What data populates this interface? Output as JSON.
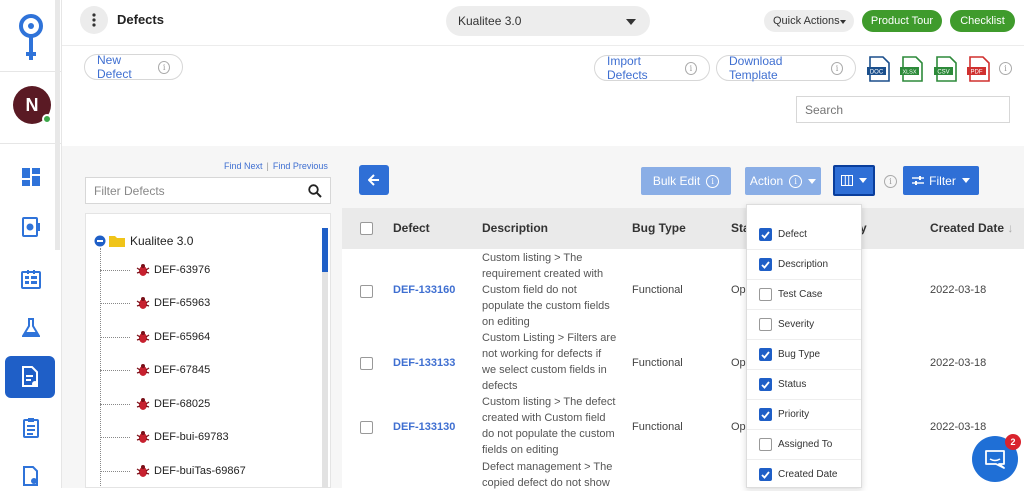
{
  "header": {
    "page_title": "Defects",
    "project": "Kualitee 3.0",
    "quick_actions": "Quick Actions",
    "product_tour": "Product Tour",
    "checklist": "Checklist"
  },
  "user": {
    "initial": "N"
  },
  "actions": {
    "new_defect": "New Defect",
    "import_defects": "Import Defects",
    "download_template": "Download Template",
    "search_placeholder": "Search",
    "file_types": [
      "DOC",
      "XLSX",
      "CSV",
      "PDF"
    ]
  },
  "tree": {
    "find_next": "Find Next",
    "find_previous": "Find Previous",
    "filter_placeholder": "Filter Defects",
    "root": "Kualitee 3.0",
    "items": [
      "DEF-63976",
      "DEF-65963",
      "DEF-65964",
      "DEF-67845",
      "DEF-68025",
      "DEF-bui-69783",
      "DEF-buiTas-69867"
    ]
  },
  "toolbar": {
    "bulk_edit": "Bulk Edit",
    "action": "Action",
    "filter": "Filter"
  },
  "table": {
    "columns": [
      "Defect",
      "Description",
      "Bug Type",
      "Sta",
      "y",
      "Created Date"
    ],
    "rows": [
      {
        "id": "DEF-133160",
        "description": [
          "Custom listing > The",
          "requirement created with",
          "Custom field do not",
          "populate the custom fields",
          "on editing"
        ],
        "bug_type": "Functional",
        "status": "Ope",
        "created": "2022-03-18"
      },
      {
        "id": "DEF-133133",
        "description": [
          "Custom Listing > Filters are",
          "not working for defects if",
          "we select custom fields in",
          "defects"
        ],
        "bug_type": "Functional",
        "status": "Ope",
        "created": "2022-03-18"
      },
      {
        "id": "DEF-133130",
        "description": [
          "Custom listing > The defect",
          "created with Custom field",
          "do not populate the custom",
          "fields on editing"
        ],
        "bug_type": "Functional",
        "status": "Ope",
        "created": "2022-03-18"
      },
      {
        "id": "",
        "description": [
          "Defect management > The",
          "copied defect do not show"
        ],
        "bug_type": "",
        "status": "",
        "created": ""
      }
    ]
  },
  "column_chooser": {
    "options": [
      {
        "label": "Defect",
        "checked": true
      },
      {
        "label": "Description",
        "checked": true
      },
      {
        "label": "Test Case",
        "checked": false
      },
      {
        "label": "Severity",
        "checked": false
      },
      {
        "label": "Bug Type",
        "checked": true
      },
      {
        "label": "Status",
        "checked": true
      },
      {
        "label": "Priority",
        "checked": true
      },
      {
        "label": "Assigned To",
        "checked": false
      },
      {
        "label": "Created Date",
        "checked": true
      }
    ]
  },
  "chat": {
    "badge": "2"
  },
  "colors": {
    "brand_blue": "#1f5fc7",
    "green": "#3f9b2c",
    "light_blue": "#8aaee6"
  }
}
